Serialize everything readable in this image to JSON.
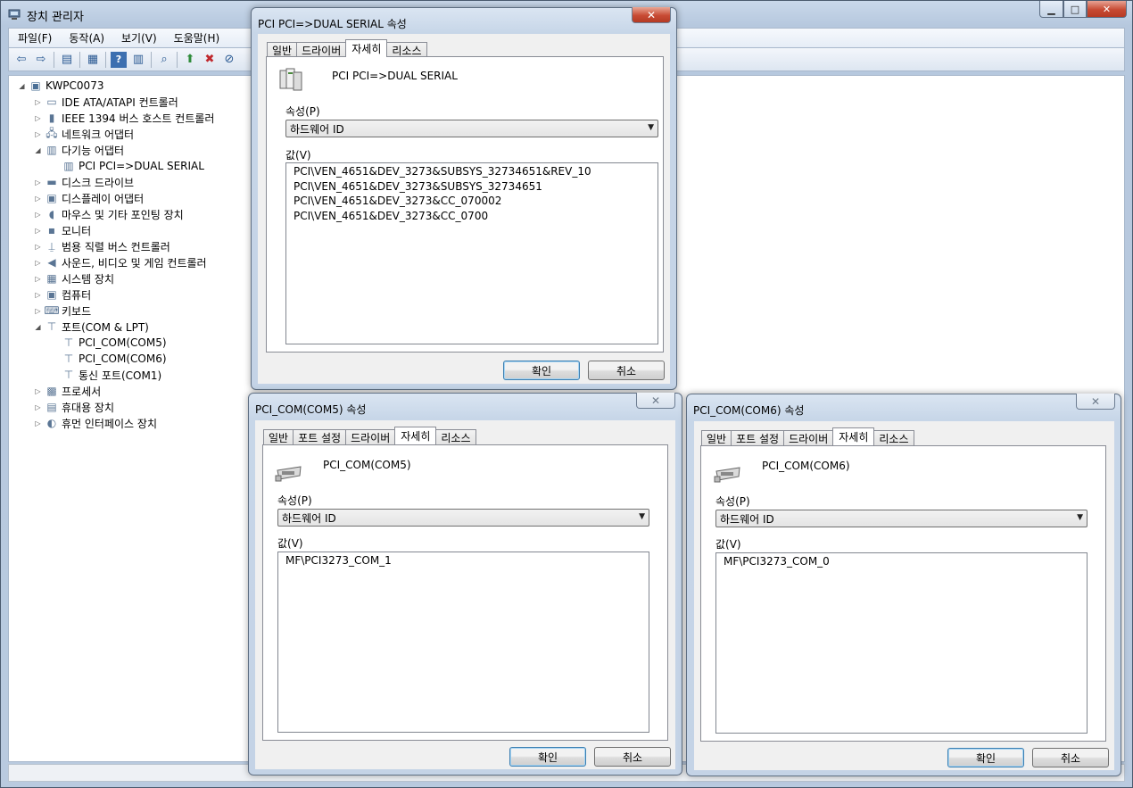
{
  "main_window": {
    "title": "장치 관리자",
    "menu": [
      "파일(F)",
      "동작(A)",
      "보기(V)",
      "도움말(H)"
    ],
    "toolbar_icons": [
      "back-icon",
      "forward-icon",
      "up-icon",
      "show-hide-icon",
      "properties-icon",
      "help-icon",
      "view-icon",
      "scan-hardware-icon",
      "update-driver-icon",
      "uninstall-icon",
      "disable-icon"
    ]
  },
  "tree": {
    "root": "KWPC0073",
    "items": [
      {
        "label": "IDE ATA/ATAPI 컨트롤러",
        "expanded": false,
        "level": 1,
        "icon": "ide-icon"
      },
      {
        "label": "IEEE 1394 버스 호스트 컨트롤러",
        "expanded": false,
        "level": 1,
        "icon": "firewire-icon"
      },
      {
        "label": "네트워크 어댑터",
        "expanded": false,
        "level": 1,
        "icon": "network-icon"
      },
      {
        "label": "다기능 어댑터",
        "expanded": true,
        "level": 1,
        "icon": "multifunction-icon"
      },
      {
        "label": "PCI PCI=>DUAL SERIAL",
        "level": 2,
        "icon": "multifunction-icon"
      },
      {
        "label": "디스크 드라이브",
        "expanded": false,
        "level": 1,
        "icon": "disk-icon"
      },
      {
        "label": "디스플레이 어댑터",
        "expanded": false,
        "level": 1,
        "icon": "display-icon"
      },
      {
        "label": "마우스 및 기타 포인팅 장치",
        "expanded": false,
        "level": 1,
        "icon": "mouse-icon"
      },
      {
        "label": "모니터",
        "expanded": false,
        "level": 1,
        "icon": "monitor-icon"
      },
      {
        "label": "범용 직렬 버스 컨트롤러",
        "expanded": false,
        "level": 1,
        "icon": "usb-icon"
      },
      {
        "label": "사운드, 비디오 및 게임 컨트롤러",
        "expanded": false,
        "level": 1,
        "icon": "sound-icon"
      },
      {
        "label": "시스템 장치",
        "expanded": false,
        "level": 1,
        "icon": "system-icon"
      },
      {
        "label": "컴퓨터",
        "expanded": false,
        "level": 1,
        "icon": "computer-icon"
      },
      {
        "label": "키보드",
        "expanded": false,
        "level": 1,
        "icon": "keyboard-icon"
      },
      {
        "label": "포트(COM & LPT)",
        "expanded": true,
        "level": 1,
        "icon": "port-icon"
      },
      {
        "label": "PCI_COM(COM5)",
        "level": 2,
        "icon": "port-icon"
      },
      {
        "label": "PCI_COM(COM6)",
        "level": 2,
        "icon": "port-icon"
      },
      {
        "label": "통신 포트(COM1)",
        "level": 2,
        "icon": "port-icon"
      },
      {
        "label": "프로세서",
        "expanded": false,
        "level": 1,
        "icon": "processor-icon"
      },
      {
        "label": "휴대용 장치",
        "expanded": false,
        "level": 1,
        "icon": "portable-icon"
      },
      {
        "label": "휴먼 인터페이스 장치",
        "expanded": false,
        "level": 1,
        "icon": "hid-icon"
      }
    ]
  },
  "dialogs": [
    {
      "title": "PCI PCI=>DUAL SERIAL 속성",
      "active": true,
      "tabs": [
        "일반",
        "드라이버",
        "자세히",
        "리소스"
      ],
      "selected_tab": "자세히",
      "device_name": "PCI PCI=>DUAL SERIAL",
      "property_label": "속성(P)",
      "property_value": "하드웨어 ID",
      "value_label": "값(V)",
      "values": [
        "PCI\\VEN_4651&DEV_3273&SUBSYS_32734651&REV_10",
        "PCI\\VEN_4651&DEV_3273&SUBSYS_32734651",
        "PCI\\VEN_4651&DEV_3273&CC_070002",
        "PCI\\VEN_4651&DEV_3273&CC_0700"
      ],
      "ok": "확인",
      "cancel": "취소"
    },
    {
      "title": "PCI_COM(COM5) 속성",
      "active": false,
      "tabs": [
        "일반",
        "포트 설정",
        "드라이버",
        "자세히",
        "리소스"
      ],
      "selected_tab": "자세히",
      "device_name": "PCI_COM(COM5)",
      "property_label": "속성(P)",
      "property_value": "하드웨어 ID",
      "value_label": "값(V)",
      "values": [
        "MF\\PCI3273_COM_1"
      ],
      "ok": "확인",
      "cancel": "취소"
    },
    {
      "title": "PCI_COM(COM6) 속성",
      "active": false,
      "tabs": [
        "일반",
        "포트 설정",
        "드라이버",
        "자세히",
        "리소스"
      ],
      "selected_tab": "자세히",
      "device_name": "PCI_COM(COM6)",
      "property_label": "속성(P)",
      "property_value": "하드웨어 ID",
      "value_label": "값(V)",
      "values": [
        "MF\\PCI3273_COM_0"
      ],
      "ok": "확인",
      "cancel": "취소"
    }
  ]
}
